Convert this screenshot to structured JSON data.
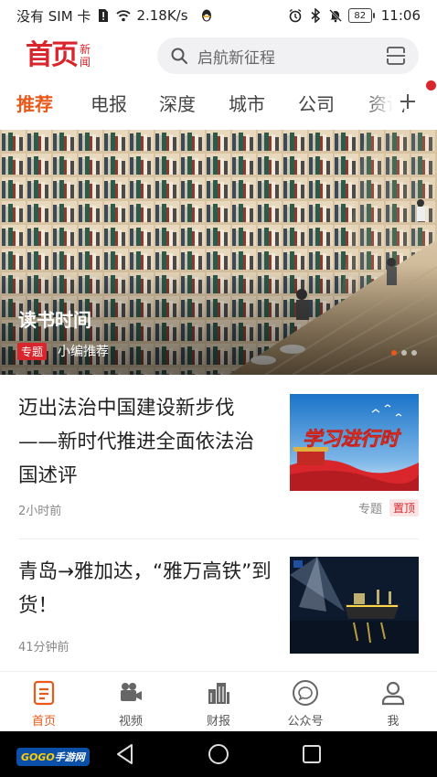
{
  "status_bar": {
    "carrier": "没有 SIM 卡",
    "network_speed": "2.18K/s",
    "battery": "82",
    "time": "11:06"
  },
  "header": {
    "logo_main": "首页",
    "logo_sub_1": "新",
    "logo_sub_2": "闻",
    "search_placeholder": "启航新征程"
  },
  "tabs": [
    {
      "label": "推荐",
      "active": true
    },
    {
      "label": "电报"
    },
    {
      "label": "深度"
    },
    {
      "label": "城市"
    },
    {
      "label": "公司"
    },
    {
      "label": "资讯"
    }
  ],
  "banner": {
    "title": "读书时间",
    "tag": "专题",
    "author": "小编推荐"
  },
  "news": [
    {
      "title": "迈出法治中国建设新步伐——新时代推进全面依法治国述评",
      "time": "2小时前",
      "topic": "专题",
      "pin": "置顶",
      "thumb_text": "学习进行时"
    },
    {
      "title": "青岛→雅加达，“雅万高铁”到货！",
      "time": "41分钟前"
    }
  ],
  "bottom_nav": [
    {
      "label": "首页",
      "icon": "home-doc-icon",
      "active": true
    },
    {
      "label": "视频",
      "icon": "video-camera-icon"
    },
    {
      "label": "财报",
      "icon": "buildings-icon"
    },
    {
      "label": "公众号",
      "icon": "chat-bubble-icon"
    },
    {
      "label": "我",
      "icon": "person-icon"
    }
  ],
  "watermark": {
    "brand": "GOGO",
    "suffix": "手游网"
  },
  "colors": {
    "accent": "#e8591a",
    "brand_red": "#d8262c"
  }
}
